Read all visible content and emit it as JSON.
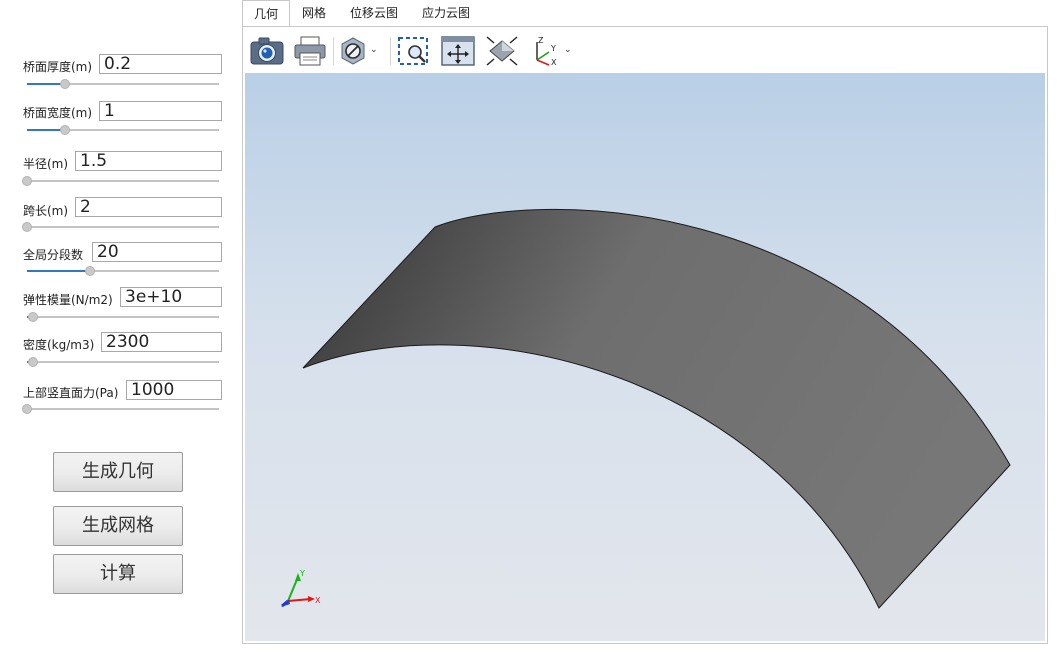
{
  "tabs": [
    {
      "label": "几何"
    },
    {
      "label": "网格"
    },
    {
      "label": "位移云图"
    },
    {
      "label": "应力云图"
    }
  ],
  "params": [
    {
      "label": "桥面厚度(m)",
      "value": "0.2",
      "slider_fraction": 0.2
    },
    {
      "label": "桥面宽度(m)",
      "value": "1",
      "slider_fraction": 0.2
    },
    {
      "label": "半径(m)",
      "value": "1.5",
      "slider_fraction": 0.0
    },
    {
      "label": "跨长(m)",
      "value": "2",
      "slider_fraction": 0.0
    },
    {
      "label": "全局分段数",
      "value": "20",
      "slider_fraction": 0.33
    },
    {
      "label": "弹性模量(N/m2)",
      "value": "3e+10",
      "slider_fraction": 0.03
    },
    {
      "label": "密度(kg/m3)",
      "value": "2300",
      "slider_fraction": 0.03
    },
    {
      "label": "上部竖直面力(Pa)",
      "value": "1000",
      "slider_fraction": 0.0
    }
  ],
  "buttons": {
    "generate_geometry": "生成几何",
    "generate_mesh": "生成网格",
    "compute": "计算"
  },
  "toolbar_icons": [
    "camera-icon",
    "print-icon",
    "display-mode-icon",
    "zoom-box-icon",
    "fit-all-icon",
    "view-cube-icon",
    "axis-orientation-icon"
  ],
  "triad": {
    "x_label": "X",
    "y_label": "Y"
  },
  "toolbar_axes": {
    "z": "Z",
    "y": "Y",
    "x": "X"
  },
  "colors": {
    "slider_fill": "#2f78c4",
    "surface_dark": "#3a3a3a",
    "surface_light": "#7a7a7a",
    "axis_x": "#e01818",
    "axis_y": "#19b219",
    "axis_z": "#1f3cd6"
  }
}
